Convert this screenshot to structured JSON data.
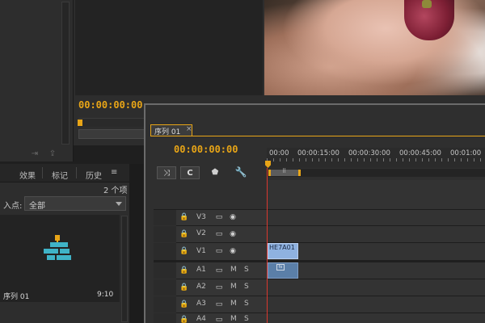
{
  "source_monitor": {
    "timecode": "00:00:00:00"
  },
  "project_panel": {
    "tabs": [
      "效果",
      "标记",
      "历史"
    ],
    "menu_glyph": "≡",
    "item_count": "2 个项",
    "in_point_label": "入点:",
    "in_point_value": "全部",
    "clip_name": "序列 01",
    "clip_duration": "9:10"
  },
  "timeline": {
    "tab_label": "序列 01",
    "tab_close": "×",
    "timecode": "00:00:00:00",
    "ruler_labels": [
      "00:00",
      "00:00:15:00",
      "00:00:30:00",
      "00:00:45:00",
      "00:01:00"
    ],
    "video_tracks": [
      "V3",
      "V2",
      "V1"
    ],
    "audio_tracks": [
      "A1",
      "A2",
      "A3",
      "A4"
    ],
    "track_mute": "M",
    "track_solo": "S",
    "video_clip_name": "HE7A01",
    "audio_clip_icon": "fx-badge-icon",
    "colors": {
      "timecode": "#e8a517",
      "playhead": "#d9382f",
      "clip_video": "#8fb2e0",
      "clip_audio": "#5b7fa8",
      "accent_border": "#e8a517"
    }
  }
}
